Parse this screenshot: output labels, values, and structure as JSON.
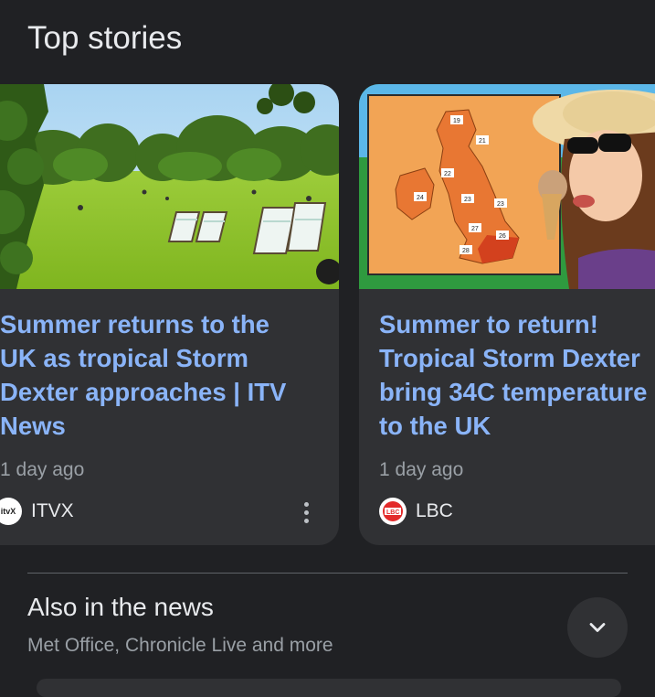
{
  "section": {
    "title": "Top stories"
  },
  "stories": [
    {
      "headline_lines": [
        "Summer returns to the",
        "UK as tropical Storm",
        "Dexter approaches | ITV",
        "News"
      ],
      "time": "1 day ago",
      "source": "ITVX",
      "source_logo_text": "itvX",
      "image_icon": "park-deckchairs-photo",
      "menu_icon": "more-vert-icon"
    },
    {
      "headline_lines": [
        "Summer to return!",
        "Tropical Storm Dexter",
        "bring 34C temperature",
        "to the UK"
      ],
      "time": "1 day ago",
      "source": "LBC",
      "source_logo_text": "LBC",
      "image_icon": "uk-heat-map-photo",
      "map_labels": [
        "19",
        "22",
        "23",
        "23",
        "24",
        "26",
        "27",
        "28",
        "21"
      ]
    }
  ],
  "also": {
    "title": "Also in the news",
    "subtitle": "Met Office, Chronicle Live and more",
    "expand_icon": "chevron-down-icon"
  },
  "colors": {
    "background": "#202124",
    "card": "#303134",
    "link": "#8ab4f8",
    "muted": "#9aa0a6"
  }
}
